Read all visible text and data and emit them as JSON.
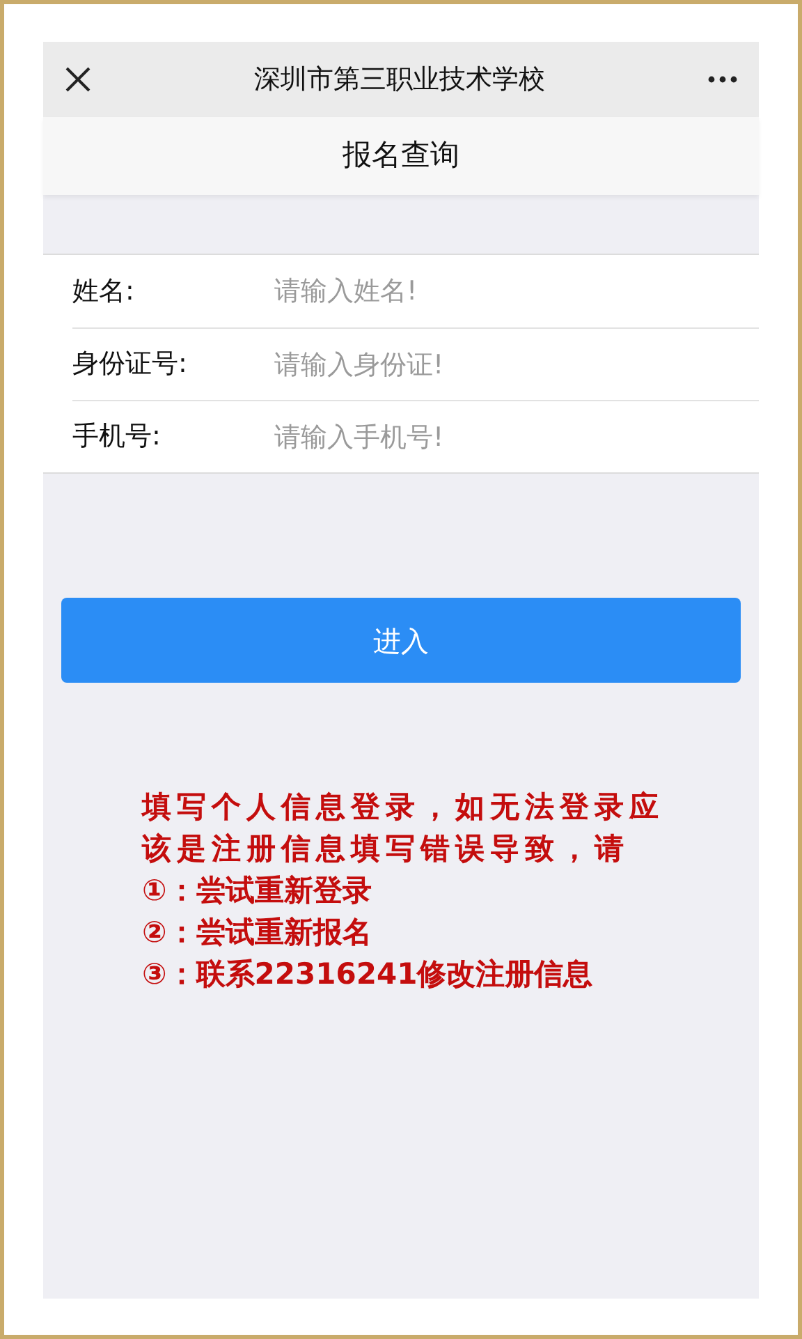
{
  "nav_bar": {
    "title": "深圳市第三职业技术学校"
  },
  "page_header": {
    "title": "报名查询"
  },
  "form_fields": [
    {
      "label": "姓名:",
      "placeholder": "请输入姓名!"
    },
    {
      "label": "身份证号:",
      "placeholder": "请输入身份证!"
    },
    {
      "label": "手机号:",
      "placeholder": "请输入手机号!"
    }
  ],
  "submit_button": {
    "label": "进入"
  },
  "notice": {
    "intro": "填写个人信息登录，如无法登录应该是注册信息填写错误导致，请",
    "steps": [
      "①：尝试重新登录",
      "②：尝试重新报名",
      "③：联系22316241修改注册信息"
    ]
  }
}
